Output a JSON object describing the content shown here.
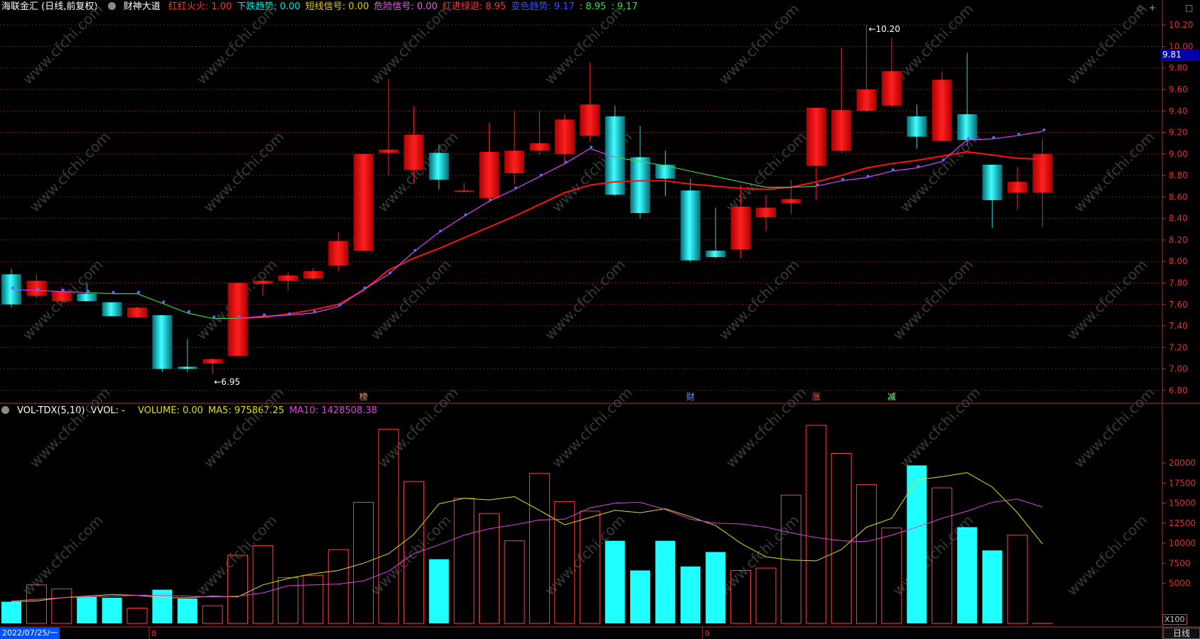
{
  "header": {
    "title": "海联金汇 (日线,前复权)",
    "indicator_name": "财神大道",
    "items": [
      {
        "text": "红红火火: 1.00",
        "color": "#ff3030"
      },
      {
        "text": "下跌趋势: 0.00",
        "color": "#00e5e5"
      },
      {
        "text": "短线信号: 0.00",
        "color": "#e0d000"
      },
      {
        "text": "危险信号: 0.00",
        "color": "#e060e0"
      },
      {
        "text": "红进绿退: 8.95",
        "color": "#ff3030"
      },
      {
        "text": "变色趋势: 9.17",
        "color": "#3050ff"
      },
      {
        "text": ": 8.95",
        "color": "#30e030"
      },
      {
        "text": ": 9.17",
        "color": "#30e030"
      }
    ]
  },
  "volume_header": {
    "name": "VOL-TDX(5,10)",
    "vvol": "VVOL: -",
    "items": [
      {
        "text": "VOLUME: 0.00",
        "color": "#e0e000"
      },
      {
        "text": "MA5: 975867.25",
        "color": "#e0e000"
      },
      {
        "text": "MA10: 1428508.38",
        "color": "#e040e0"
      }
    ]
  },
  "price_axis": {
    "ticks": [
      "10.20",
      "10.00",
      "9.80",
      "9.60",
      "9.40",
      "9.20",
      "9.00",
      "8.80",
      "8.60",
      "8.40",
      "8.20",
      "8.00",
      "7.80",
      "7.60",
      "7.40",
      "7.20",
      "7.00",
      "6.80"
    ]
  },
  "volume_axis": {
    "ticks": [
      "20000",
      "17500",
      "15000",
      "12500",
      "10000",
      "7500",
      "5000"
    ]
  },
  "current_price_tag": "9.81",
  "volume_unit": "X100",
  "annotations": {
    "high": "10.20",
    "low": "6.95"
  },
  "markers": [
    {
      "text": "榜",
      "color": "#e8a060"
    },
    {
      "text": "财",
      "color": "#6a9aff"
    },
    {
      "text": "涨",
      "color": "#ff6060"
    },
    {
      "text": "减",
      "color": "#80ff80"
    }
  ],
  "date_axis": {
    "start": "2022/07/25/一",
    "months": [
      "8",
      "9"
    ]
  },
  "period": "日线",
  "watermark": "www.cfchi.com",
  "chart_data": {
    "type": "candlestick",
    "ylim": [
      6.7,
      10.3
    ],
    "candles": [
      {
        "o": 7.88,
        "h": 7.93,
        "l": 7.57,
        "c": 7.6
      },
      {
        "o": 7.68,
        "h": 7.88,
        "l": 7.66,
        "c": 7.82
      },
      {
        "o": 7.63,
        "h": 7.76,
        "l": 7.61,
        "c": 7.72
      },
      {
        "o": 7.7,
        "h": 7.8,
        "l": 7.63,
        "c": 7.63
      },
      {
        "o": 7.62,
        "h": 7.62,
        "l": 7.49,
        "c": 7.49
      },
      {
        "o": 7.48,
        "h": 7.58,
        "l": 7.48,
        "c": 7.57
      },
      {
        "o": 7.5,
        "h": 7.5,
        "l": 6.97,
        "c": 7.0
      },
      {
        "o": 7.02,
        "h": 7.28,
        "l": 6.97,
        "c": 7.0
      },
      {
        "o": 7.05,
        "h": 7.1,
        "l": 6.95,
        "c": 7.09
      },
      {
        "o": 7.12,
        "h": 7.8,
        "l": 7.12,
        "c": 7.8
      },
      {
        "o": 7.79,
        "h": 7.83,
        "l": 7.68,
        "c": 7.82
      },
      {
        "o": 7.82,
        "h": 7.9,
        "l": 7.73,
        "c": 7.87
      },
      {
        "o": 7.84,
        "h": 7.94,
        "l": 7.83,
        "c": 7.91
      },
      {
        "o": 7.96,
        "h": 8.27,
        "l": 7.91,
        "c": 8.19
      },
      {
        "o": 8.1,
        "h": 9.0,
        "l": 8.1,
        "c": 9.0
      },
      {
        "o": 9.01,
        "h": 9.7,
        "l": 8.8,
        "c": 9.04
      },
      {
        "o": 8.85,
        "h": 9.44,
        "l": 8.73,
        "c": 9.18
      },
      {
        "o": 9.01,
        "h": 9.09,
        "l": 8.67,
        "c": 8.76
      },
      {
        "o": 8.66,
        "h": 8.73,
        "l": 8.65,
        "c": 8.66
      },
      {
        "o": 8.59,
        "h": 9.29,
        "l": 8.55,
        "c": 9.02
      },
      {
        "o": 8.82,
        "h": 9.4,
        "l": 8.72,
        "c": 9.03
      },
      {
        "o": 9.03,
        "h": 9.4,
        "l": 8.99,
        "c": 9.1
      },
      {
        "o": 9.0,
        "h": 9.37,
        "l": 8.9,
        "c": 9.32
      },
      {
        "o": 9.17,
        "h": 9.85,
        "l": 9.11,
        "c": 9.46
      },
      {
        "o": 9.35,
        "h": 9.45,
        "l": 8.61,
        "c": 8.62
      },
      {
        "o": 8.97,
        "h": 9.26,
        "l": 8.4,
        "c": 8.45
      },
      {
        "o": 8.9,
        "h": 9.03,
        "l": 8.61,
        "c": 8.77
      },
      {
        "o": 8.66,
        "h": 8.77,
        "l": 7.99,
        "c": 8.01
      },
      {
        "o": 8.1,
        "h": 8.5,
        "l": 8.03,
        "c": 8.04
      },
      {
        "o": 8.11,
        "h": 8.71,
        "l": 8.03,
        "c": 8.51
      },
      {
        "o": 8.41,
        "h": 8.62,
        "l": 8.28,
        "c": 8.5
      },
      {
        "o": 8.54,
        "h": 8.76,
        "l": 8.44,
        "c": 8.58
      },
      {
        "o": 8.89,
        "h": 9.43,
        "l": 8.57,
        "c": 9.43
      },
      {
        "o": 9.03,
        "h": 9.99,
        "l": 9.01,
        "c": 9.41
      },
      {
        "o": 9.4,
        "h": 10.2,
        "l": 9.39,
        "c": 9.6
      },
      {
        "o": 9.45,
        "h": 10.08,
        "l": 9.43,
        "c": 9.77
      },
      {
        "o": 9.35,
        "h": 9.46,
        "l": 9.05,
        "c": 9.16
      },
      {
        "o": 9.12,
        "h": 9.77,
        "l": 9.12,
        "c": 9.69
      },
      {
        "o": 9.37,
        "h": 9.94,
        "l": 9.08,
        "c": 9.13
      },
      {
        "o": 8.9,
        "h": 8.9,
        "l": 8.31,
        "c": 8.57
      },
      {
        "o": 8.64,
        "h": 8.88,
        "l": 8.48,
        "c": 8.74
      },
      {
        "o": 8.64,
        "h": 9.14,
        "l": 8.32,
        "c": 9.0
      }
    ],
    "ma_red": [
      null,
      null,
      null,
      null,
      null,
      null,
      null,
      null,
      null,
      7.47,
      7.48,
      7.51,
      7.55,
      7.6,
      7.73,
      7.92,
      8.03,
      8.12,
      8.22,
      8.32,
      8.42,
      8.53,
      8.64,
      8.71,
      8.74,
      8.75,
      8.75,
      8.72,
      8.7,
      8.68,
      8.67,
      8.69,
      8.74,
      8.8,
      8.87,
      8.91,
      8.94,
      8.98,
      9.02,
      8.99,
      8.96,
      8.95
    ],
    "ma_colored": [
      7.74,
      7.73,
      7.72,
      7.71,
      7.7,
      7.7,
      7.61,
      7.52,
      7.47,
      7.47,
      7.49,
      7.5,
      7.52,
      7.58,
      7.74,
      7.88,
      8.09,
      8.27,
      8.42,
      8.56,
      8.67,
      8.79,
      8.91,
      9.05,
      8.97,
      8.93,
      8.89,
      8.84,
      8.79,
      8.74,
      8.69,
      8.69,
      8.7,
      8.75,
      8.78,
      8.84,
      8.87,
      8.93,
      9.13,
      9.14,
      9.17,
      9.21
    ],
    "ma_colored_signal": [
      true,
      true,
      true,
      false,
      false,
      false,
      false,
      false,
      false,
      true,
      true,
      true,
      true,
      true,
      true,
      true,
      true,
      true,
      true,
      true,
      true,
      true,
      true,
      true,
      false,
      false,
      false,
      false,
      false,
      false,
      false,
      false,
      true,
      true,
      true,
      true,
      true,
      true,
      true,
      true,
      true,
      true
    ],
    "trend_dots": [
      true,
      true,
      true,
      true,
      true,
      true,
      true,
      true,
      true,
      true,
      true,
      true,
      true,
      true,
      true,
      true,
      true,
      true,
      true,
      true,
      true,
      true,
      true,
      true,
      false,
      false,
      false,
      false,
      false,
      false,
      false,
      false,
      true,
      true,
      true,
      true,
      true,
      true,
      true,
      true,
      true,
      true
    ],
    "volume": [
      2.7,
      4.8,
      4.3,
      3.3,
      3.2,
      1.9,
      4.2,
      3.1,
      2.2,
      8.5,
      9.7,
      5.7,
      6.0,
      9.2,
      15.1,
      24.2,
      17.7,
      8.0,
      15.6,
      13.7,
      10.3,
      18.7,
      15.2,
      14.0,
      10.3,
      6.6,
      10.3,
      7.1,
      8.9,
      6.6,
      6.9,
      16.0,
      24.7,
      21.2,
      17.3,
      11.9,
      19.7,
      16.9,
      12.0,
      9.1,
      11.0,
      0.01
    ],
    "vol_ma5": [
      2.7,
      2.8,
      3.2,
      3.4,
      3.6,
      3.5,
      3.2,
      3.2,
      3.4,
      3.3,
      4.8,
      5.6,
      6.2,
      6.6,
      7.5,
      8.7,
      11.1,
      14.9,
      15.6,
      15.4,
      15.8,
      14.1,
      12.3,
      13.2,
      14.1,
      13.8,
      14.3,
      13.3,
      12.2,
      10.0,
      8.3,
      7.9,
      7.8,
      9.2,
      12.0,
      13.1,
      17.9,
      18.3,
      18.8,
      17.0,
      13.8,
      9.9
    ],
    "vol_ma10": [
      2.8,
      3.0,
      3.2,
      3.3,
      3.4,
      3.5,
      3.5,
      3.4,
      3.3,
      3.4,
      3.8,
      4.7,
      4.8,
      4.9,
      5.3,
      6.5,
      8.7,
      9.8,
      11.0,
      11.8,
      12.3,
      12.9,
      13.0,
      14.4,
      15.0,
      15.1,
      14.2,
      13.0,
      12.5,
      12.4,
      12.0,
      11.3,
      10.7,
      10.3,
      10.2,
      11.0,
      12.0,
      13.1,
      14.0,
      15.1,
      15.5,
      14.5
    ],
    "vol_ylim": [
      0,
      25.5
    ]
  }
}
